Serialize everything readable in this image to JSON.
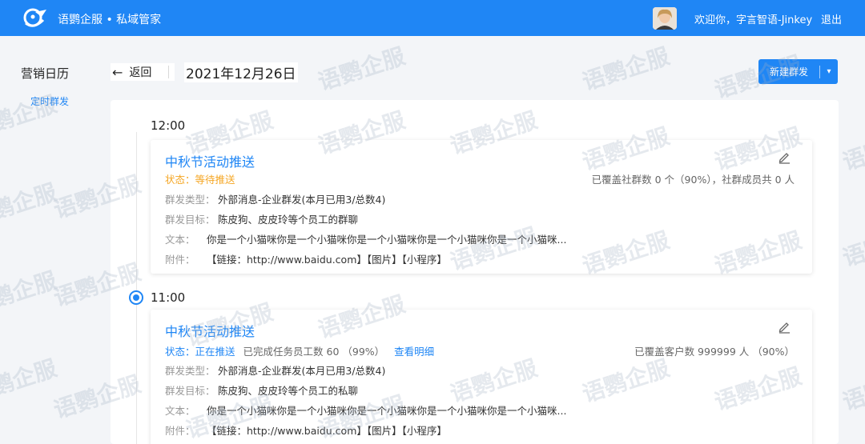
{
  "header": {
    "brand": "语鹦企服 • 私域管家",
    "welcome": "欢迎你，字言智语-Jinkey",
    "logout": "退出"
  },
  "sidebar": {
    "title": "营销日历",
    "link": "定时群发"
  },
  "toolbar": {
    "back": "返回",
    "date": "2021年12月26日",
    "new_button": "新建群发"
  },
  "watermark": "语鹦企服",
  "colors": {
    "primary": "#1f86f5",
    "pending": "#f5a623"
  },
  "timeline": [
    {
      "time": "12:00",
      "title": "中秋节活动推送",
      "status_label": "状态：",
      "status_value": "等待推送",
      "coverage": "已覆盖社群数 0 个（90%），社群成员共 0 人",
      "type_label": "群发类型：",
      "type_value": "外部消息-企业群发(本月已用3/总数4)",
      "target_label": "群发目标：",
      "target_value": "陈皮狗、皮皮玲等个员工的群聊",
      "text_label": "文本：",
      "text_value": "你是一个小猫咪你是一个小猫咪你是一个小猫咪你是一个小猫咪你是一个小猫咪...",
      "attach_label": "附件：",
      "attach_value": "【链接：http://www.baidu.com】【图片】【小程序】"
    },
    {
      "time": "11:00",
      "title": "中秋节活动推送",
      "status_label": "状态：",
      "status_value": "正在推送",
      "done_text": "已完成任务员工数 60 （99%）",
      "detail_link": "查看明细",
      "coverage": "已覆盖客户数 999999 人 （90%）",
      "type_label": "群发类型：",
      "type_value": "外部消息-企业群发(本月已用3/总数4)",
      "target_label": "群发目标：",
      "target_value": "陈皮狗、皮皮玲等个员工的私聊",
      "text_label": "文本：",
      "text_value": "你是一个小猫咪你是一个小猫咪你是一个小猫咪你是一个小猫咪你是一个小猫咪...",
      "attach_label": "附件：",
      "attach_value": "【链接：http://www.baidu.com】【图片】【小程序】"
    }
  ]
}
